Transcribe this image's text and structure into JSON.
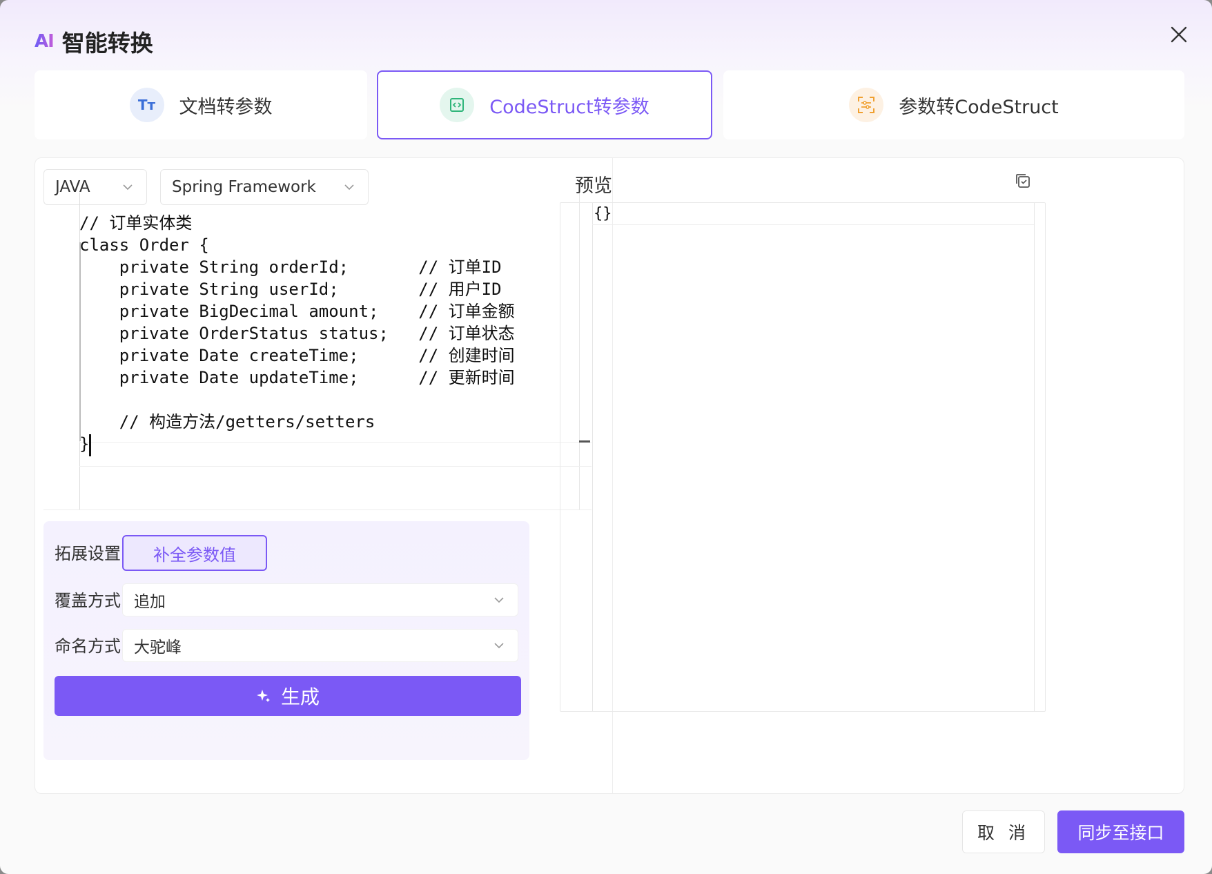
{
  "dialog": {
    "logo_text": "AI",
    "title": "智能转换",
    "close_label": "✕"
  },
  "tabs": [
    {
      "label": "文档转参数",
      "icon": "text-format-icon",
      "icon_text": "Tт",
      "active": false
    },
    {
      "label": "CodeStruct转参数",
      "icon": "code-icon",
      "active": true
    },
    {
      "label": "参数转CodeStruct",
      "icon": "scan-icon",
      "active": false
    }
  ],
  "source": {
    "language": "JAVA",
    "framework": "Spring Framework",
    "code_lines": [
      "// 订单实体类",
      "class Order {",
      "    private String orderId;       // 订单ID",
      "    private String userId;        // 用户ID",
      "    private BigDecimal amount;    // 订单金额",
      "    private OrderStatus status;   // 订单状态",
      "    private Date createTime;      // 创建时间",
      "    private Date updateTime;      // 更新时间",
      "",
      "    // 构造方法/getters/setters",
      "}"
    ]
  },
  "settings": {
    "extension_label": "拓展设置",
    "fill_button": "补全参数值",
    "cover_label": "覆盖方式",
    "cover_value": "追加",
    "naming_label": "命名方式",
    "naming_value": "大驼峰",
    "generate_button": "生成"
  },
  "preview": {
    "title": "预览",
    "content": "{}"
  },
  "footer": {
    "cancel": "取 消",
    "sync": "同步至接口"
  },
  "colors": {
    "accent": "#7b59f5",
    "accent_light": "#ede8fe"
  }
}
